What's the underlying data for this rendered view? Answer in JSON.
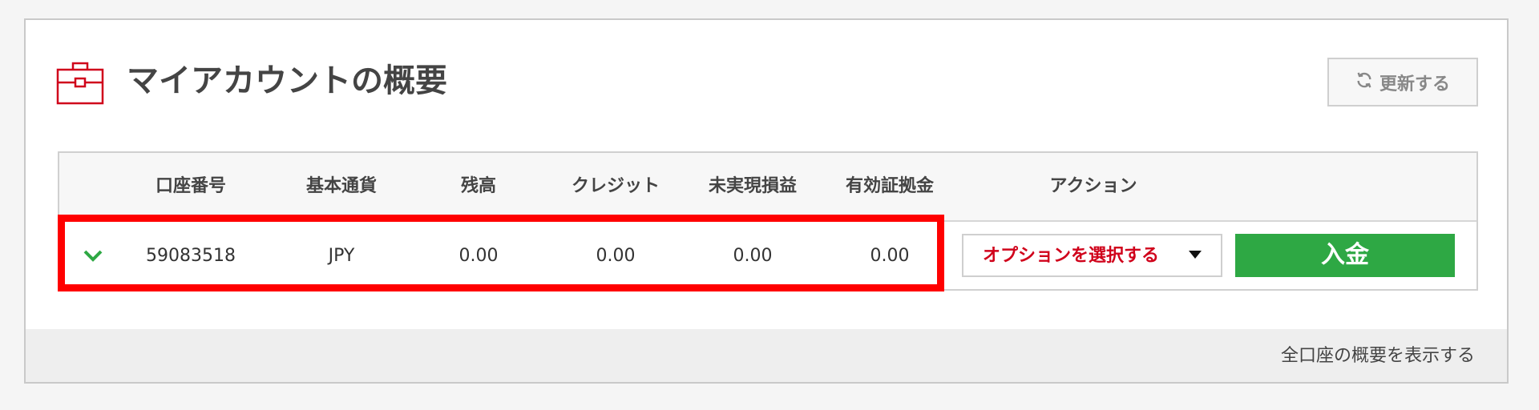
{
  "header": {
    "title": "マイアカウントの概要",
    "icon": "briefcase-icon",
    "refresh_label": "更新する",
    "refresh_icon": "refresh-icon"
  },
  "table": {
    "columns": [
      "口座番号",
      "基本通貨",
      "残高",
      "クレジット",
      "未実現損益",
      "有効証拠金",
      "アクション"
    ],
    "rows": [
      {
        "account_number": "59083518",
        "currency": "JPY",
        "balance": "0.00",
        "credit": "0.00",
        "unrealized_pl": "0.00",
        "equity": "0.00"
      }
    ],
    "expand_icon": "chevron-down-icon"
  },
  "actions": {
    "select_placeholder": "オプションを選択する",
    "deposit_label": "入金"
  },
  "footer": {
    "link": "全口座の概要を表示する"
  },
  "colors": {
    "accent_red": "#d0021b",
    "highlight_red": "#ff0000",
    "deposit_green": "#2ea844",
    "chevron_green": "#2ea844"
  }
}
